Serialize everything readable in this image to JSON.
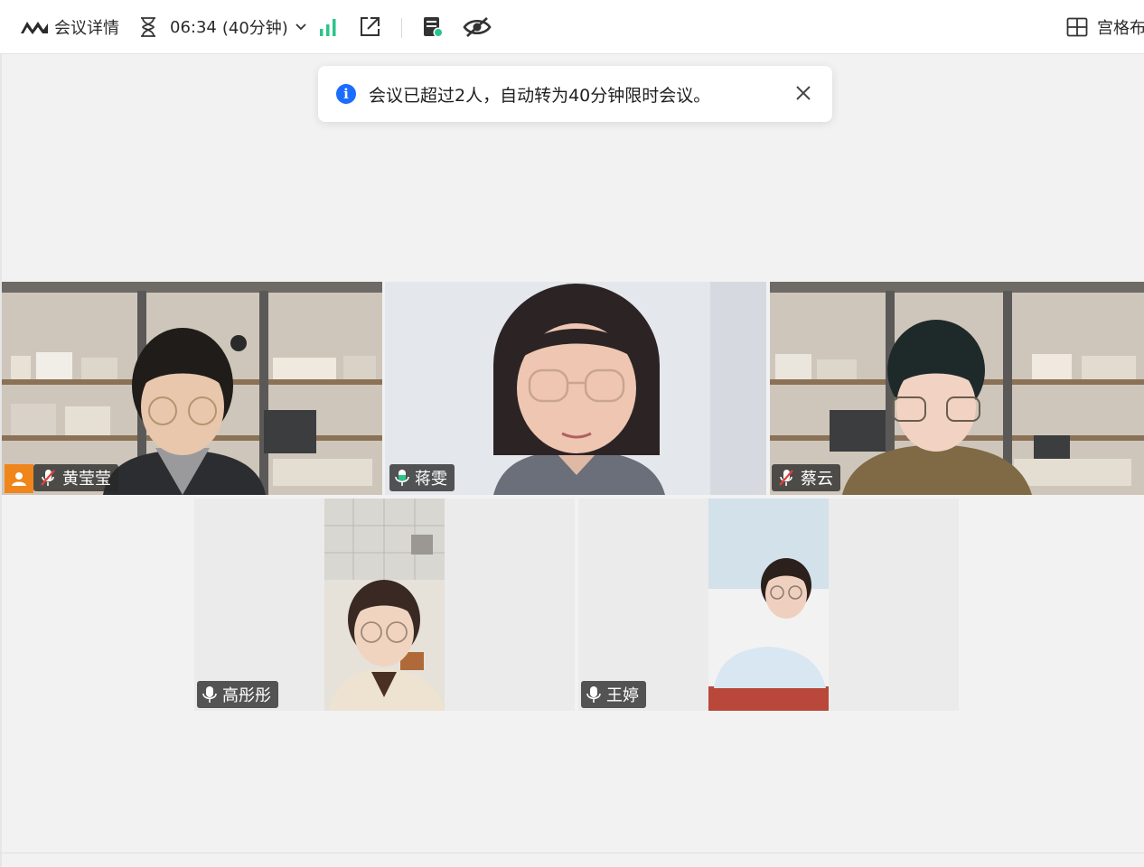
{
  "toolbar": {
    "meeting_info_label": "会议详情",
    "time_elapsed": "06:34",
    "time_limit": "(40分钟)",
    "layout_label": "宫格布"
  },
  "toast": {
    "message": "会议已超过2人，自动转为40分钟限时会议。"
  },
  "participants": [
    {
      "name": "黄莹莹",
      "mic": "muted",
      "is_host": true
    },
    {
      "name": "蒋雯",
      "mic": "speaking",
      "active_speaker": true
    },
    {
      "name": "蔡云",
      "mic": "muted"
    },
    {
      "name": "高彤彤",
      "mic": "on"
    },
    {
      "name": "王婷",
      "mic": "on"
    }
  ],
  "icons": {
    "logo": "meeting-logo-icon",
    "timer": "hourglass-icon",
    "signal": "network-signal-icon",
    "share": "share-external-icon",
    "record": "record-notes-icon",
    "hide": "hide-video-icon",
    "layout": "grid-layout-icon",
    "info": "info-icon",
    "close": "close-icon"
  },
  "colors": {
    "active_border": "#2bc48a",
    "host_badge": "#f0861b",
    "info_blue": "#1a6dff",
    "signal_green": "#2bc48a",
    "muted_red": "#e5413a"
  }
}
